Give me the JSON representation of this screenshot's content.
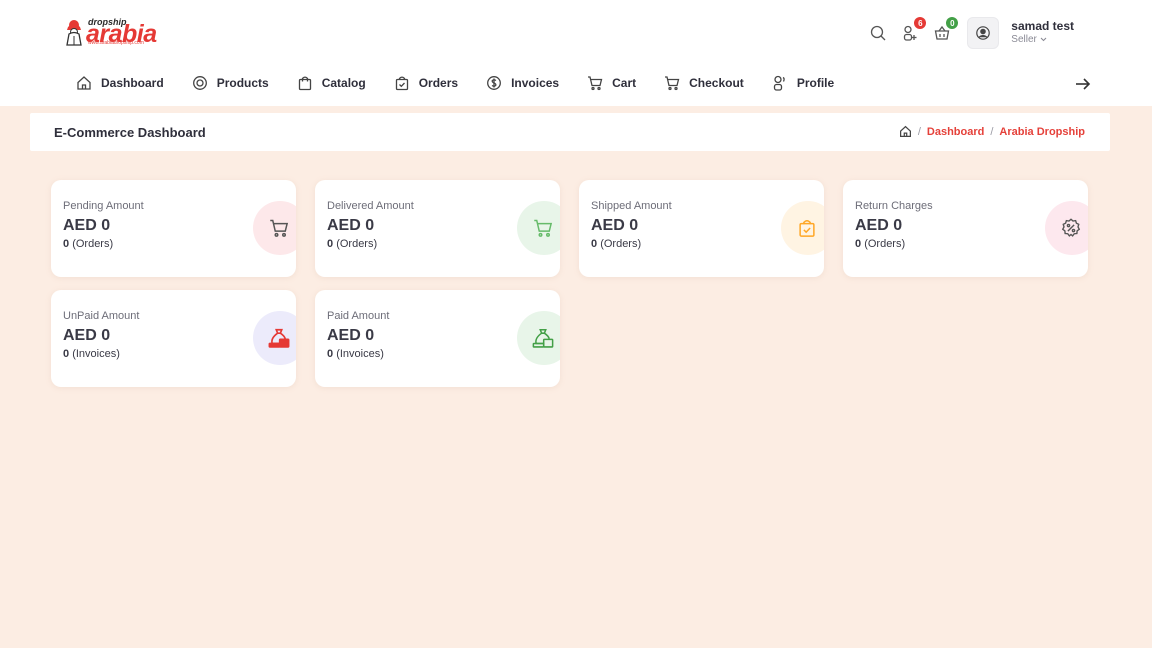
{
  "logo": {
    "small": "dropship",
    "main": "arabia",
    "url": "www.arabiadropship.com"
  },
  "header": {
    "badges": {
      "users_count": "6",
      "cart_count": "0"
    },
    "user": {
      "name": "samad test",
      "role": "Seller"
    }
  },
  "nav": {
    "items": [
      {
        "label": "Dashboard",
        "icon": "home-icon"
      },
      {
        "label": "Products",
        "icon": "target-icon"
      },
      {
        "label": "Catalog",
        "icon": "shopping-bag-icon"
      },
      {
        "label": "Orders",
        "icon": "bag-check-icon"
      },
      {
        "label": "Invoices",
        "icon": "money-icon"
      },
      {
        "label": "Cart",
        "icon": "cart-icon"
      },
      {
        "label": "Checkout",
        "icon": "cart-icon"
      },
      {
        "label": "Profile",
        "icon": "users-icon"
      }
    ]
  },
  "page": {
    "title": "E-Commerce Dashboard",
    "breadcrumb": [
      "Dashboard",
      "Arabia Dropship"
    ]
  },
  "cards": [
    {
      "label": "Pending Amount",
      "amount": "AED 0",
      "count": "0",
      "unit": "(Orders)",
      "icon": "cart-icon",
      "color": "#ef5350"
    },
    {
      "label": "Delivered Amount",
      "amount": "AED 0",
      "count": "0",
      "unit": "(Orders)",
      "icon": "cart-icon",
      "color": "#66bb6a"
    },
    {
      "label": "Shipped Amount",
      "amount": "AED 0",
      "count": "0",
      "unit": "(Orders)",
      "icon": "box-check-icon",
      "color": "#ffa726"
    },
    {
      "label": "Return Charges",
      "amount": "AED 0",
      "count": "0",
      "unit": "(Orders)",
      "icon": "discount-icon",
      "color": "#ec407a"
    },
    {
      "label": "UnPaid Amount",
      "amount": "AED 0",
      "count": "0",
      "unit": "(Invoices)",
      "icon": "money-bag-icon",
      "color": "#e53935"
    },
    {
      "label": "Paid Amount",
      "amount": "AED 0",
      "count": "0",
      "unit": "(Invoices)",
      "icon": "money-bag-icon",
      "color": "#43a047"
    }
  ]
}
